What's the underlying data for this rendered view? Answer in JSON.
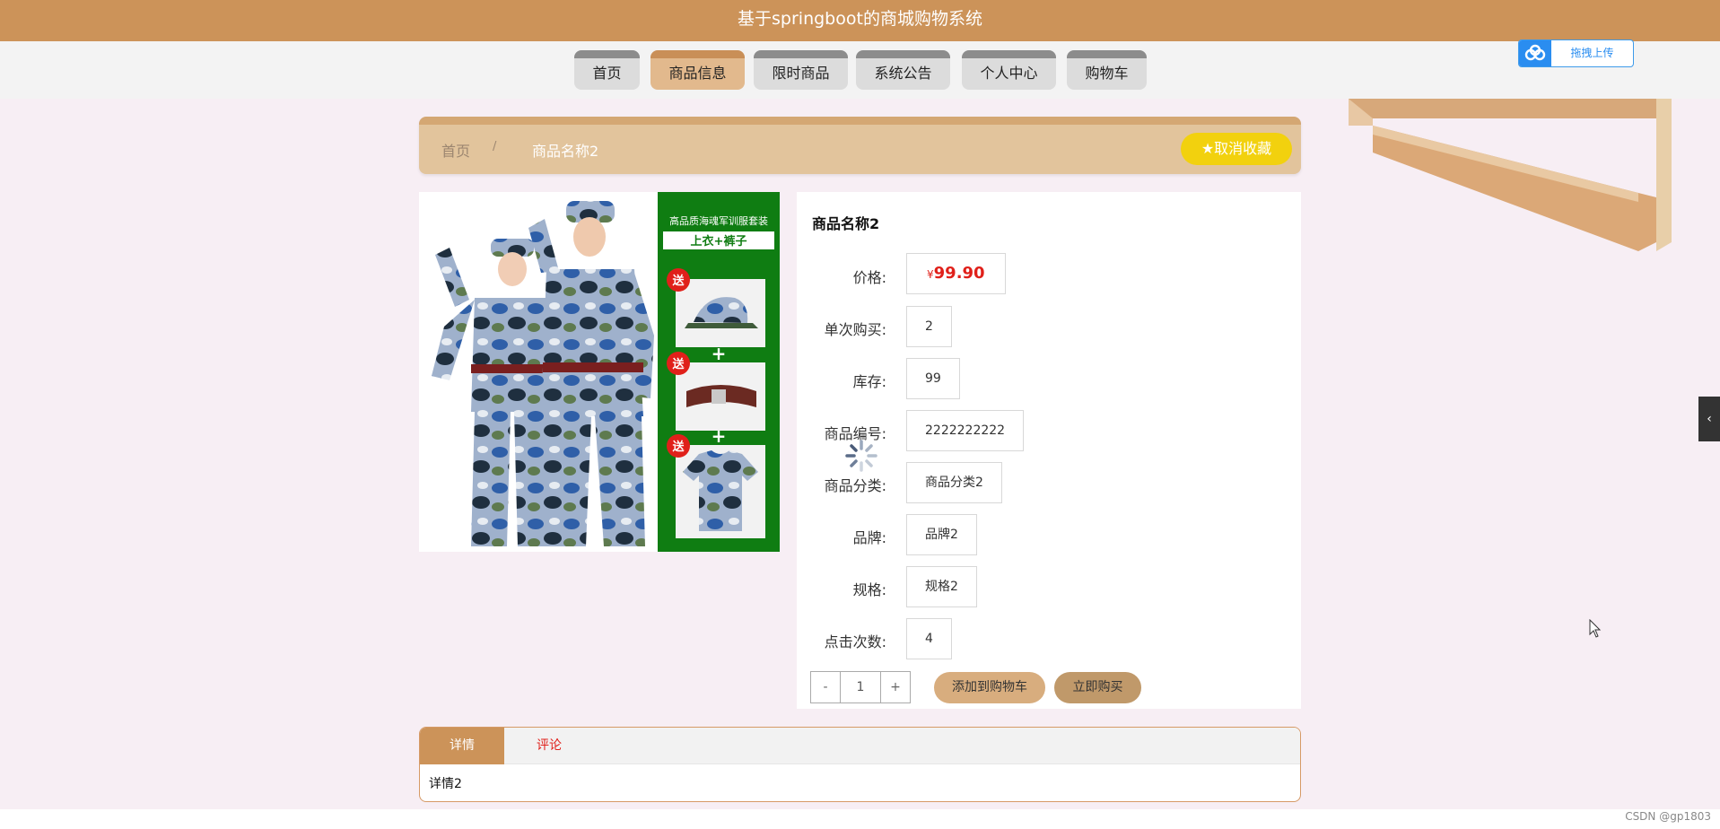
{
  "header": {
    "title": "基于springboot的商城购物系统"
  },
  "nav": {
    "items": [
      {
        "label": "首页"
      },
      {
        "label": "商品信息"
      },
      {
        "label": "限时商品"
      },
      {
        "label": "系统公告"
      },
      {
        "label": "个人中心"
      },
      {
        "label": "购物车"
      }
    ],
    "active_index": 1,
    "active_color": "#e2b98d"
  },
  "upload": {
    "label": "拖拽上传"
  },
  "breadcrumb": {
    "home": "首页",
    "separator": "/",
    "current": "商品名称2"
  },
  "favorite": {
    "label": "取消收藏",
    "icon": "star-icon"
  },
  "product_image": {
    "banner_title": "高品质海魂军训服套装",
    "banner_subtitle": "上衣+裤子",
    "gift_badge": "送",
    "plus": "+",
    "gifts": [
      "cap-icon",
      "belt-icon",
      "tshirt-icon"
    ]
  },
  "product": {
    "name": "商品名称2",
    "currency": "¥",
    "price": "99.90",
    "price_color": "#e0201a",
    "fields": [
      {
        "label": "价格:"
      },
      {
        "label": "单次购买:",
        "value": "2"
      },
      {
        "label": "库存:",
        "value": "99"
      },
      {
        "label": "商品编号:",
        "value": "2222222222"
      },
      {
        "label": "商品分类:",
        "value": "商品分类2"
      },
      {
        "label": "品牌:",
        "value": "品牌2"
      },
      {
        "label": "规格:",
        "value": "规格2"
      },
      {
        "label": "点击次数:",
        "value": "4"
      }
    ]
  },
  "quantity": {
    "minus": "-",
    "value": "1",
    "plus": "+"
  },
  "actions": {
    "add_to_cart": "添加到购物车",
    "buy_now": "立即购买"
  },
  "tabs": {
    "items": [
      {
        "label": "详情"
      },
      {
        "label": "评论"
      }
    ],
    "content": "详情2"
  },
  "side_tab": {
    "icon": "chevron-left-icon",
    "glyph": "‹"
  },
  "watermark": "CSDN @gp1803"
}
